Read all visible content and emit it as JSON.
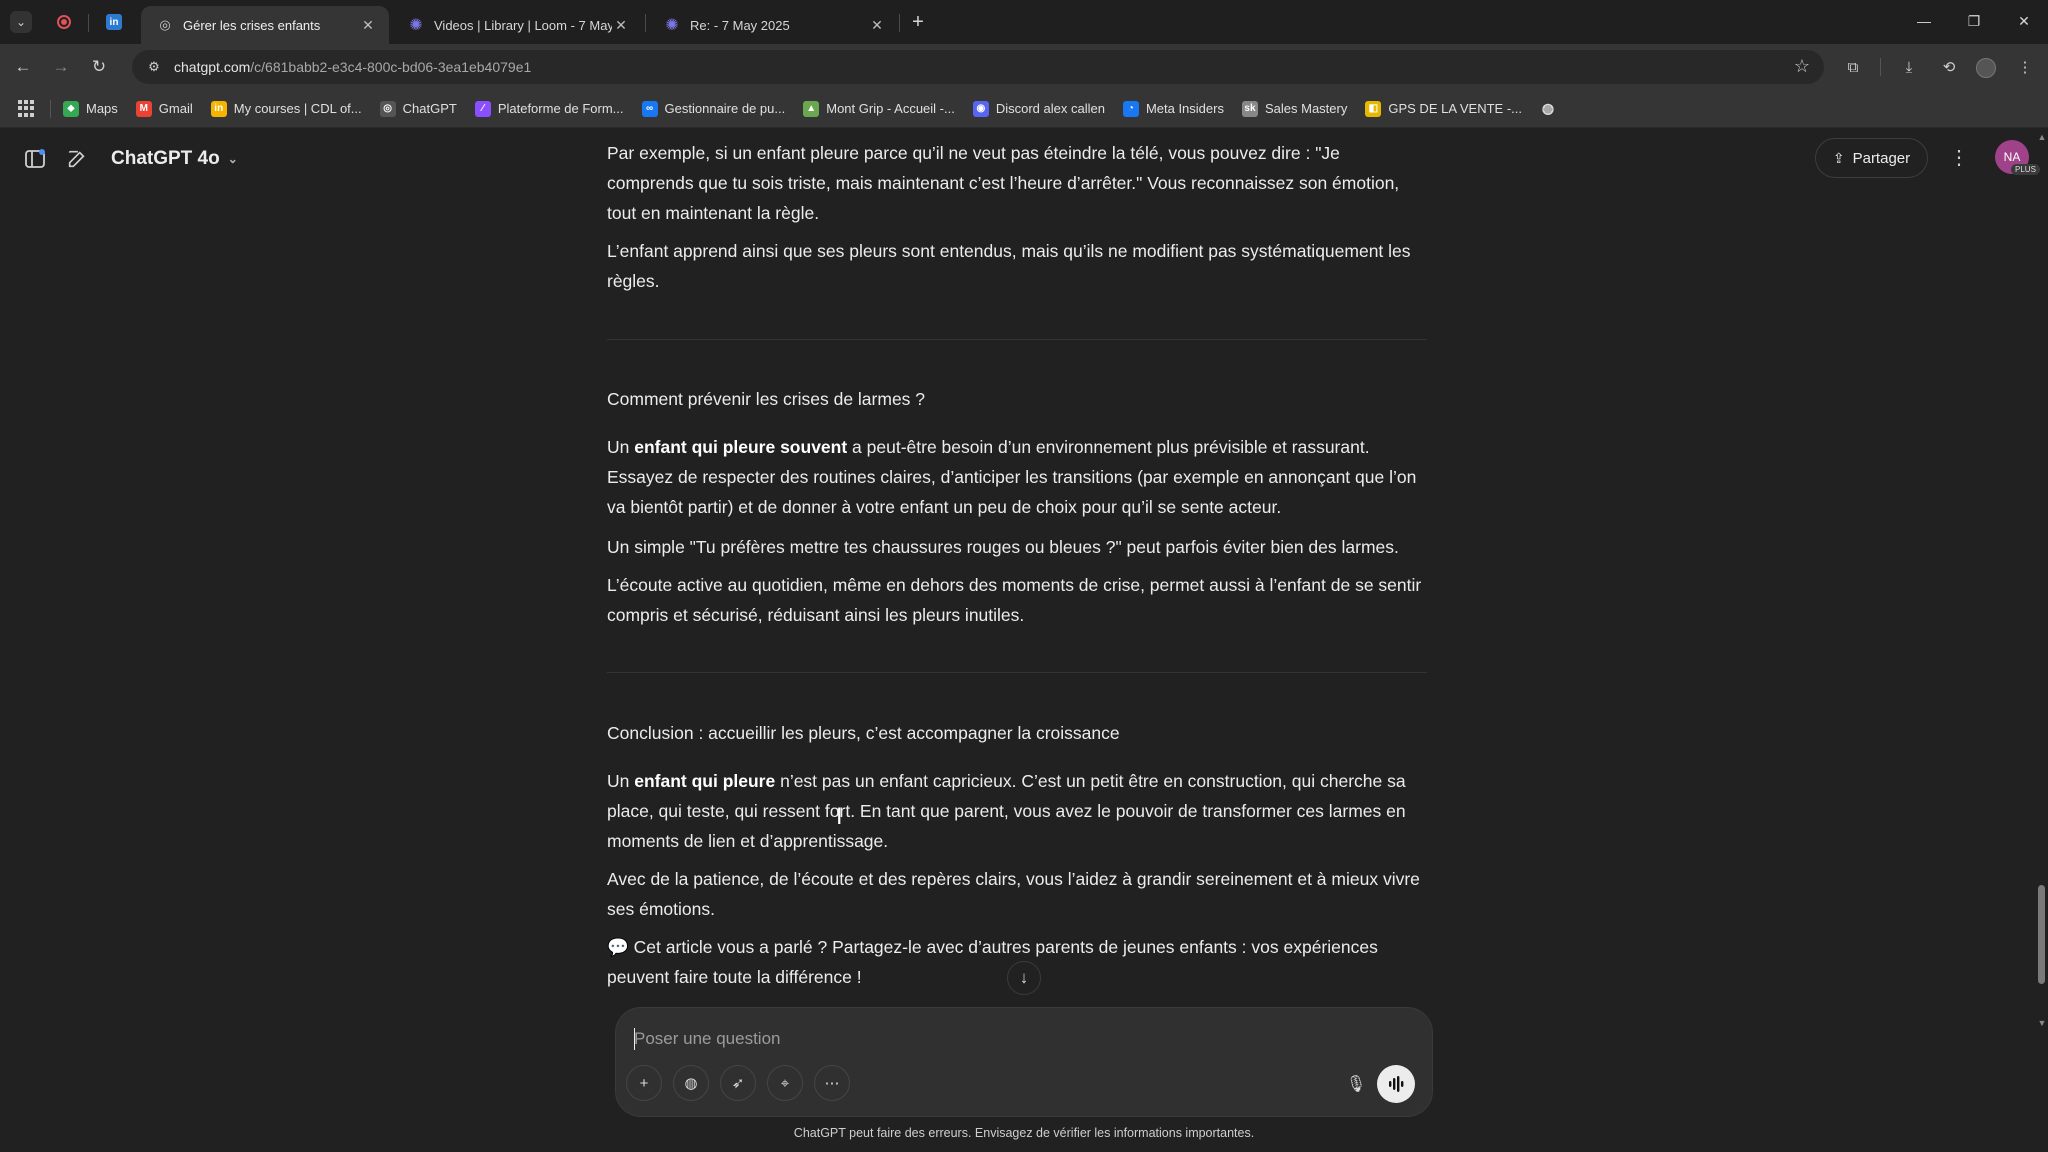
{
  "browser": {
    "tabs": [
      {
        "title": "Gérer les crises enfants",
        "active": true,
        "icon": "chatgpt-icon"
      },
      {
        "title": "Videos | Library | Loom - 7 May",
        "active": false,
        "icon": "loom-icon"
      },
      {
        "title": "Re: - 7 May 2025",
        "active": false,
        "icon": "loom-icon"
      }
    ],
    "url_host": "chatgpt.com",
    "url_path": "/c/681babb2-e3c4-800c-bd06-3ea1eb4079e1",
    "bookmarks": [
      {
        "label": "Maps",
        "color": "#34a853",
        "glyph": "⬥"
      },
      {
        "label": "Gmail",
        "color": "#ea4335",
        "glyph": "M"
      },
      {
        "label": "My courses | CDL of...",
        "color": "#f4b400",
        "glyph": "in"
      },
      {
        "label": "ChatGPT",
        "color": "#555555",
        "glyph": "◎"
      },
      {
        "label": "Plateforme de Form...",
        "color": "#8a4fff",
        "glyph": "⁄"
      },
      {
        "label": "Gestionnaire de pu...",
        "color": "#1877f2",
        "glyph": "∞"
      },
      {
        "label": "Mont Grip - Accueil -...",
        "color": "#6aa84f",
        "glyph": "▲"
      },
      {
        "label": "Discord alex callen",
        "color": "#5865f2",
        "glyph": "◉"
      },
      {
        "label": "Meta Insiders",
        "color": "#1877f2",
        "glyph": "◔"
      },
      {
        "label": "Sales Mastery",
        "color": "#888888",
        "glyph": "sk"
      },
      {
        "label": "GPS DE LA VENTE -...",
        "color": "#e6b800",
        "glyph": "◧"
      }
    ]
  },
  "header": {
    "model": "ChatGPT 4o",
    "share_label": "Partager",
    "avatar_initials": "NA",
    "avatar_badge": "PLUS"
  },
  "content": {
    "p1": "Par exemple, si un enfant pleure parce qu’il ne veut pas éteindre la télé, vous pouvez dire : \"Je comprends que tu sois triste, mais maintenant c’est l’heure d’arrêter.\" Vous reconnaissez son émotion, tout en maintenant la règle.",
    "p2": "L’enfant apprend ainsi que ses pleurs sont entendus, mais qu’ils ne modifient pas systématiquement les règles.",
    "h1": "Comment prévenir les crises de larmes ?",
    "p3_pre": "Un ",
    "p3_bold": "enfant qui pleure souvent",
    "p3_post": " a peut-être besoin d’un environnement plus prévisible et rassurant. Essayez de respecter des routines claires, d’anticiper les transitions (par exemple en annonçant que l’on va bientôt partir) et de donner à votre enfant un peu de choix pour qu’il se sente acteur.",
    "p4": "Un simple \"Tu préfères mettre tes chaussures rouges ou bleues ?\" peut parfois éviter bien des larmes.",
    "p5": "L’écoute active au quotidien, même en dehors des moments de crise, permet aussi à l’enfant de se sentir compris et sécurisé, réduisant ainsi les pleurs inutiles.",
    "h2": "Conclusion : accueillir les pleurs, c’est accompagner la croissance",
    "p6_pre": "Un ",
    "p6_bold": "enfant qui pleure",
    "p6_post": " n’est pas un enfant capricieux. C’est un petit être en construction, qui cherche sa place, qui teste, qui ressent fort. En tant que parent, vous avez le pouvoir de transformer ces larmes en moments de lien et d’apprentissage.",
    "p7": "Avec de la patience, de l’écoute et des repères clairs, vous l’aidez à grandir sereinement et à mieux vivre ses émotions.",
    "p8_emoji": "💬",
    "p8": "Cet article vous a parlé ? Partagez-le avec d’autres parents de jeunes enfants : vos expériences peuvent faire toute la différence !"
  },
  "composer": {
    "placeholder": "Poser une question"
  },
  "disclaimer": "ChatGPT peut faire des erreurs. Envisagez de vérifier les informations importantes."
}
